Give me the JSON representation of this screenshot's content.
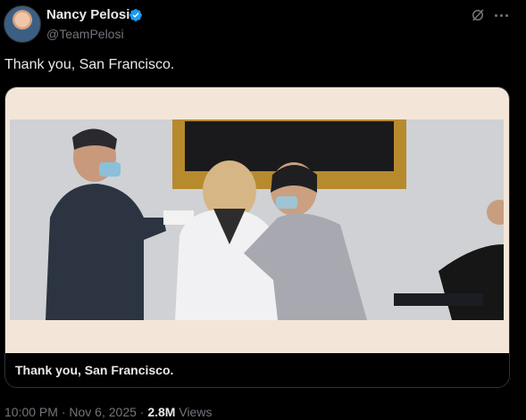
{
  "user": {
    "display_name": "Nancy Pelosi",
    "handle": "@TeamPelosi",
    "verified": true
  },
  "tweet": {
    "text": "Thank you, San Francisco.",
    "media_caption": "Thank you, San Francisco."
  },
  "meta": {
    "time": "10:00 PM",
    "date": "Nov 6, 2025",
    "separator": "·",
    "views_count": "2.8M",
    "views_label": "Views"
  },
  "icons": {
    "avatar": "profile-avatar",
    "verified": "verified-badge-icon",
    "grok": "grok-icon",
    "more": "more-options-icon"
  },
  "colors": {
    "background": "#000000",
    "text_primary": "#e7e9ea",
    "text_secondary": "#71767b",
    "verified_blue": "#1d9bf0",
    "video_border": "#f3e6d8"
  }
}
